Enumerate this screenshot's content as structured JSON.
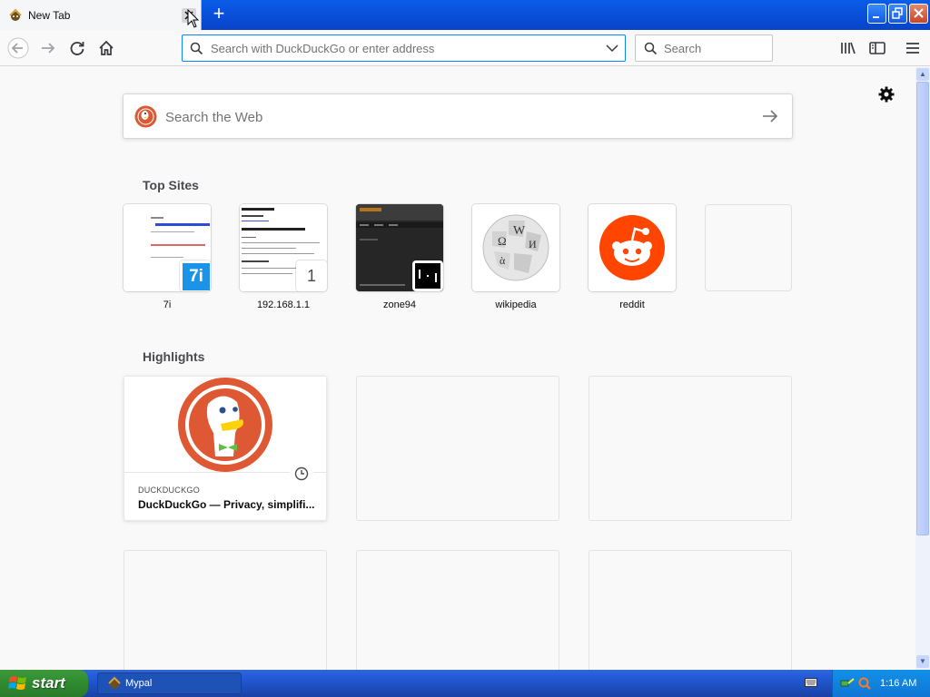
{
  "window": {
    "tab_title": "New Tab",
    "new_tab_symbol": "+"
  },
  "toolbar": {
    "url_placeholder": "Search with DuckDuckGo or enter address",
    "search_placeholder": "Search"
  },
  "page": {
    "web_search_placeholder": "Search the Web",
    "top_sites_title": "Top Sites",
    "highlights_title": "Highlights"
  },
  "top_sites": [
    {
      "label": "7i",
      "icon": "7i-icon"
    },
    {
      "label": "192.168.1.1",
      "icon": "page-thumbnail",
      "badge": "1"
    },
    {
      "label": "zone94",
      "icon": "zone94-thumbnail"
    },
    {
      "label": "wikipedia",
      "icon": "wikipedia-globe-icon"
    },
    {
      "label": "reddit",
      "icon": "reddit-alien-icon"
    },
    {
      "label": "",
      "icon": ""
    }
  ],
  "highlights": [
    {
      "source": "DUCKDUCKGO",
      "title": "DuckDuckGo — Privacy, simplifi..."
    }
  ],
  "taskbar": {
    "start_label": "start",
    "task_label": "Mypal",
    "clock": "1:16 AM"
  },
  "colors": {
    "accent": "#0a84ff",
    "reddit": "#ff4500",
    "duckduckgo": "#de5833",
    "xp_blue": "#245edb",
    "start_green": "#3c9a3c"
  }
}
